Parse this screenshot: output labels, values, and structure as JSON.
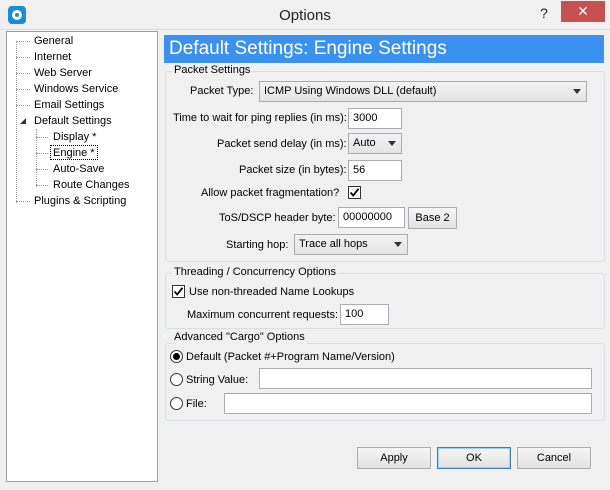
{
  "window": {
    "title": "Options",
    "help": "?",
    "close": "✕"
  },
  "tree": {
    "items": [
      {
        "label": "General"
      },
      {
        "label": "Internet"
      },
      {
        "label": "Web Server"
      },
      {
        "label": "Windows Service"
      },
      {
        "label": "Email Settings"
      },
      {
        "label": "Default Settings"
      },
      {
        "label": "Display *"
      },
      {
        "label": "Engine *"
      },
      {
        "label": "Auto-Save"
      },
      {
        "label": "Route Changes"
      },
      {
        "label": "Plugins & Scripting"
      }
    ]
  },
  "header": {
    "title": "Default Settings: Engine Settings"
  },
  "packet": {
    "group_title": "Packet Settings",
    "type_label": "Packet Type:",
    "type_value": "ICMP Using Windows DLL (default)",
    "timeout_label": "Time to wait for ping replies (in ms):",
    "timeout_value": "3000",
    "delay_label": "Packet send delay (in ms):",
    "delay_value": "Auto",
    "size_label": "Packet size (in bytes):",
    "size_value": "56",
    "frag_label": "Allow packet fragmentation?",
    "frag_checked": true,
    "tos_label": "ToS/DSCP header byte:",
    "tos_value": "00000000",
    "base_button": "Base 2",
    "hop_label": "Starting hop:",
    "hop_value": "Trace all hops"
  },
  "threading": {
    "group_title": "Threading / Concurrency Options",
    "nonthreaded_label": "Use non-threaded Name Lookups",
    "nonthreaded_checked": true,
    "max_label": "Maximum concurrent requests:",
    "max_value": "100"
  },
  "cargo": {
    "group_title": "Advanced \"Cargo\" Options",
    "default_label": "Default (Packet #+Program Name/Version)",
    "string_label": "String Value:",
    "string_value": "",
    "file_label": "File:",
    "file_value": "",
    "selected": "default"
  },
  "footer": {
    "apply": "Apply",
    "ok": "OK",
    "cancel": "Cancel"
  }
}
